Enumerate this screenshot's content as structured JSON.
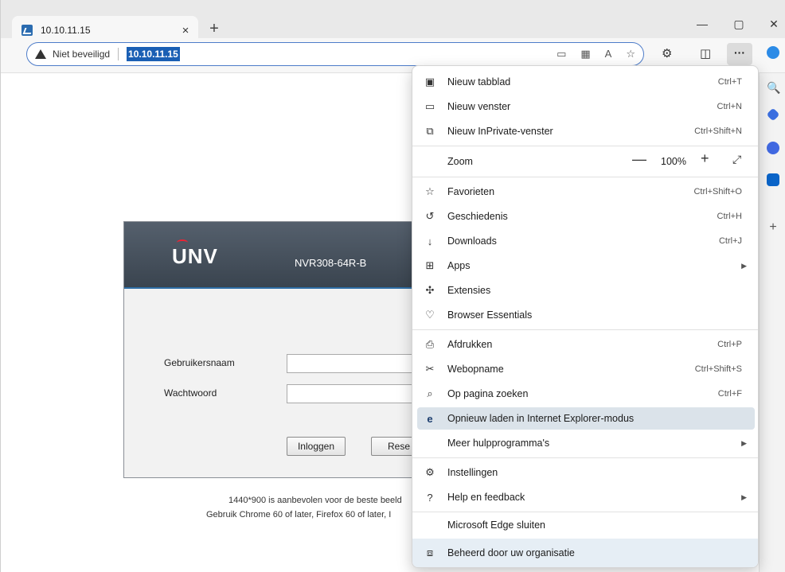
{
  "tab": {
    "title": "10.10.11.15",
    "close": "×"
  },
  "newtab": "+",
  "window": {
    "min": "—",
    "max": "▢",
    "close": "✕"
  },
  "address": {
    "security": "Niet beveiligd",
    "url": "10.10.11.15"
  },
  "login": {
    "logo": "UNV",
    "model": "NVR308-64R-B",
    "username_label": "Gebruikersnaam",
    "password_label": "Wachtwoord",
    "login_button": "Inloggen",
    "reset_button": "Rese",
    "note1": "1440*900 is aanbevolen voor de beste beeld",
    "note2": "Gebruik Chrome 60 of later, Firefox 60 of later, I"
  },
  "menu": {
    "new_tab": {
      "label": "Nieuw tabblad",
      "shortcut": "Ctrl+T"
    },
    "new_window": {
      "label": "Nieuw venster",
      "shortcut": "Ctrl+N"
    },
    "new_private": {
      "label": "Nieuw InPrivate-venster",
      "shortcut": "Ctrl+Shift+N"
    },
    "zoom": {
      "label": "Zoom",
      "minus": "—",
      "value": "100%",
      "plus": "+",
      "full": "⤢"
    },
    "favorites": {
      "label": "Favorieten",
      "shortcut": "Ctrl+Shift+O"
    },
    "history": {
      "label": "Geschiedenis",
      "shortcut": "Ctrl+H"
    },
    "downloads": {
      "label": "Downloads",
      "shortcut": "Ctrl+J"
    },
    "apps": {
      "label": "Apps"
    },
    "extensions": {
      "label": "Extensies"
    },
    "essentials": {
      "label": "Browser Essentials"
    },
    "print": {
      "label": "Afdrukken",
      "shortcut": "Ctrl+P"
    },
    "webcapture": {
      "label": "Webopname",
      "shortcut": "Ctrl+Shift+S"
    },
    "find": {
      "label": "Op pagina zoeken",
      "shortcut": "Ctrl+F"
    },
    "ie_mode": {
      "label": "Opnieuw laden in Internet Explorer-modus"
    },
    "more_tools": {
      "label": "Meer hulpprogramma's"
    },
    "settings": {
      "label": "Instellingen"
    },
    "help": {
      "label": "Help en feedback"
    },
    "close_edge": {
      "label": "Microsoft Edge sluiten"
    },
    "managed": {
      "label": "Beheerd door uw organisatie"
    }
  }
}
